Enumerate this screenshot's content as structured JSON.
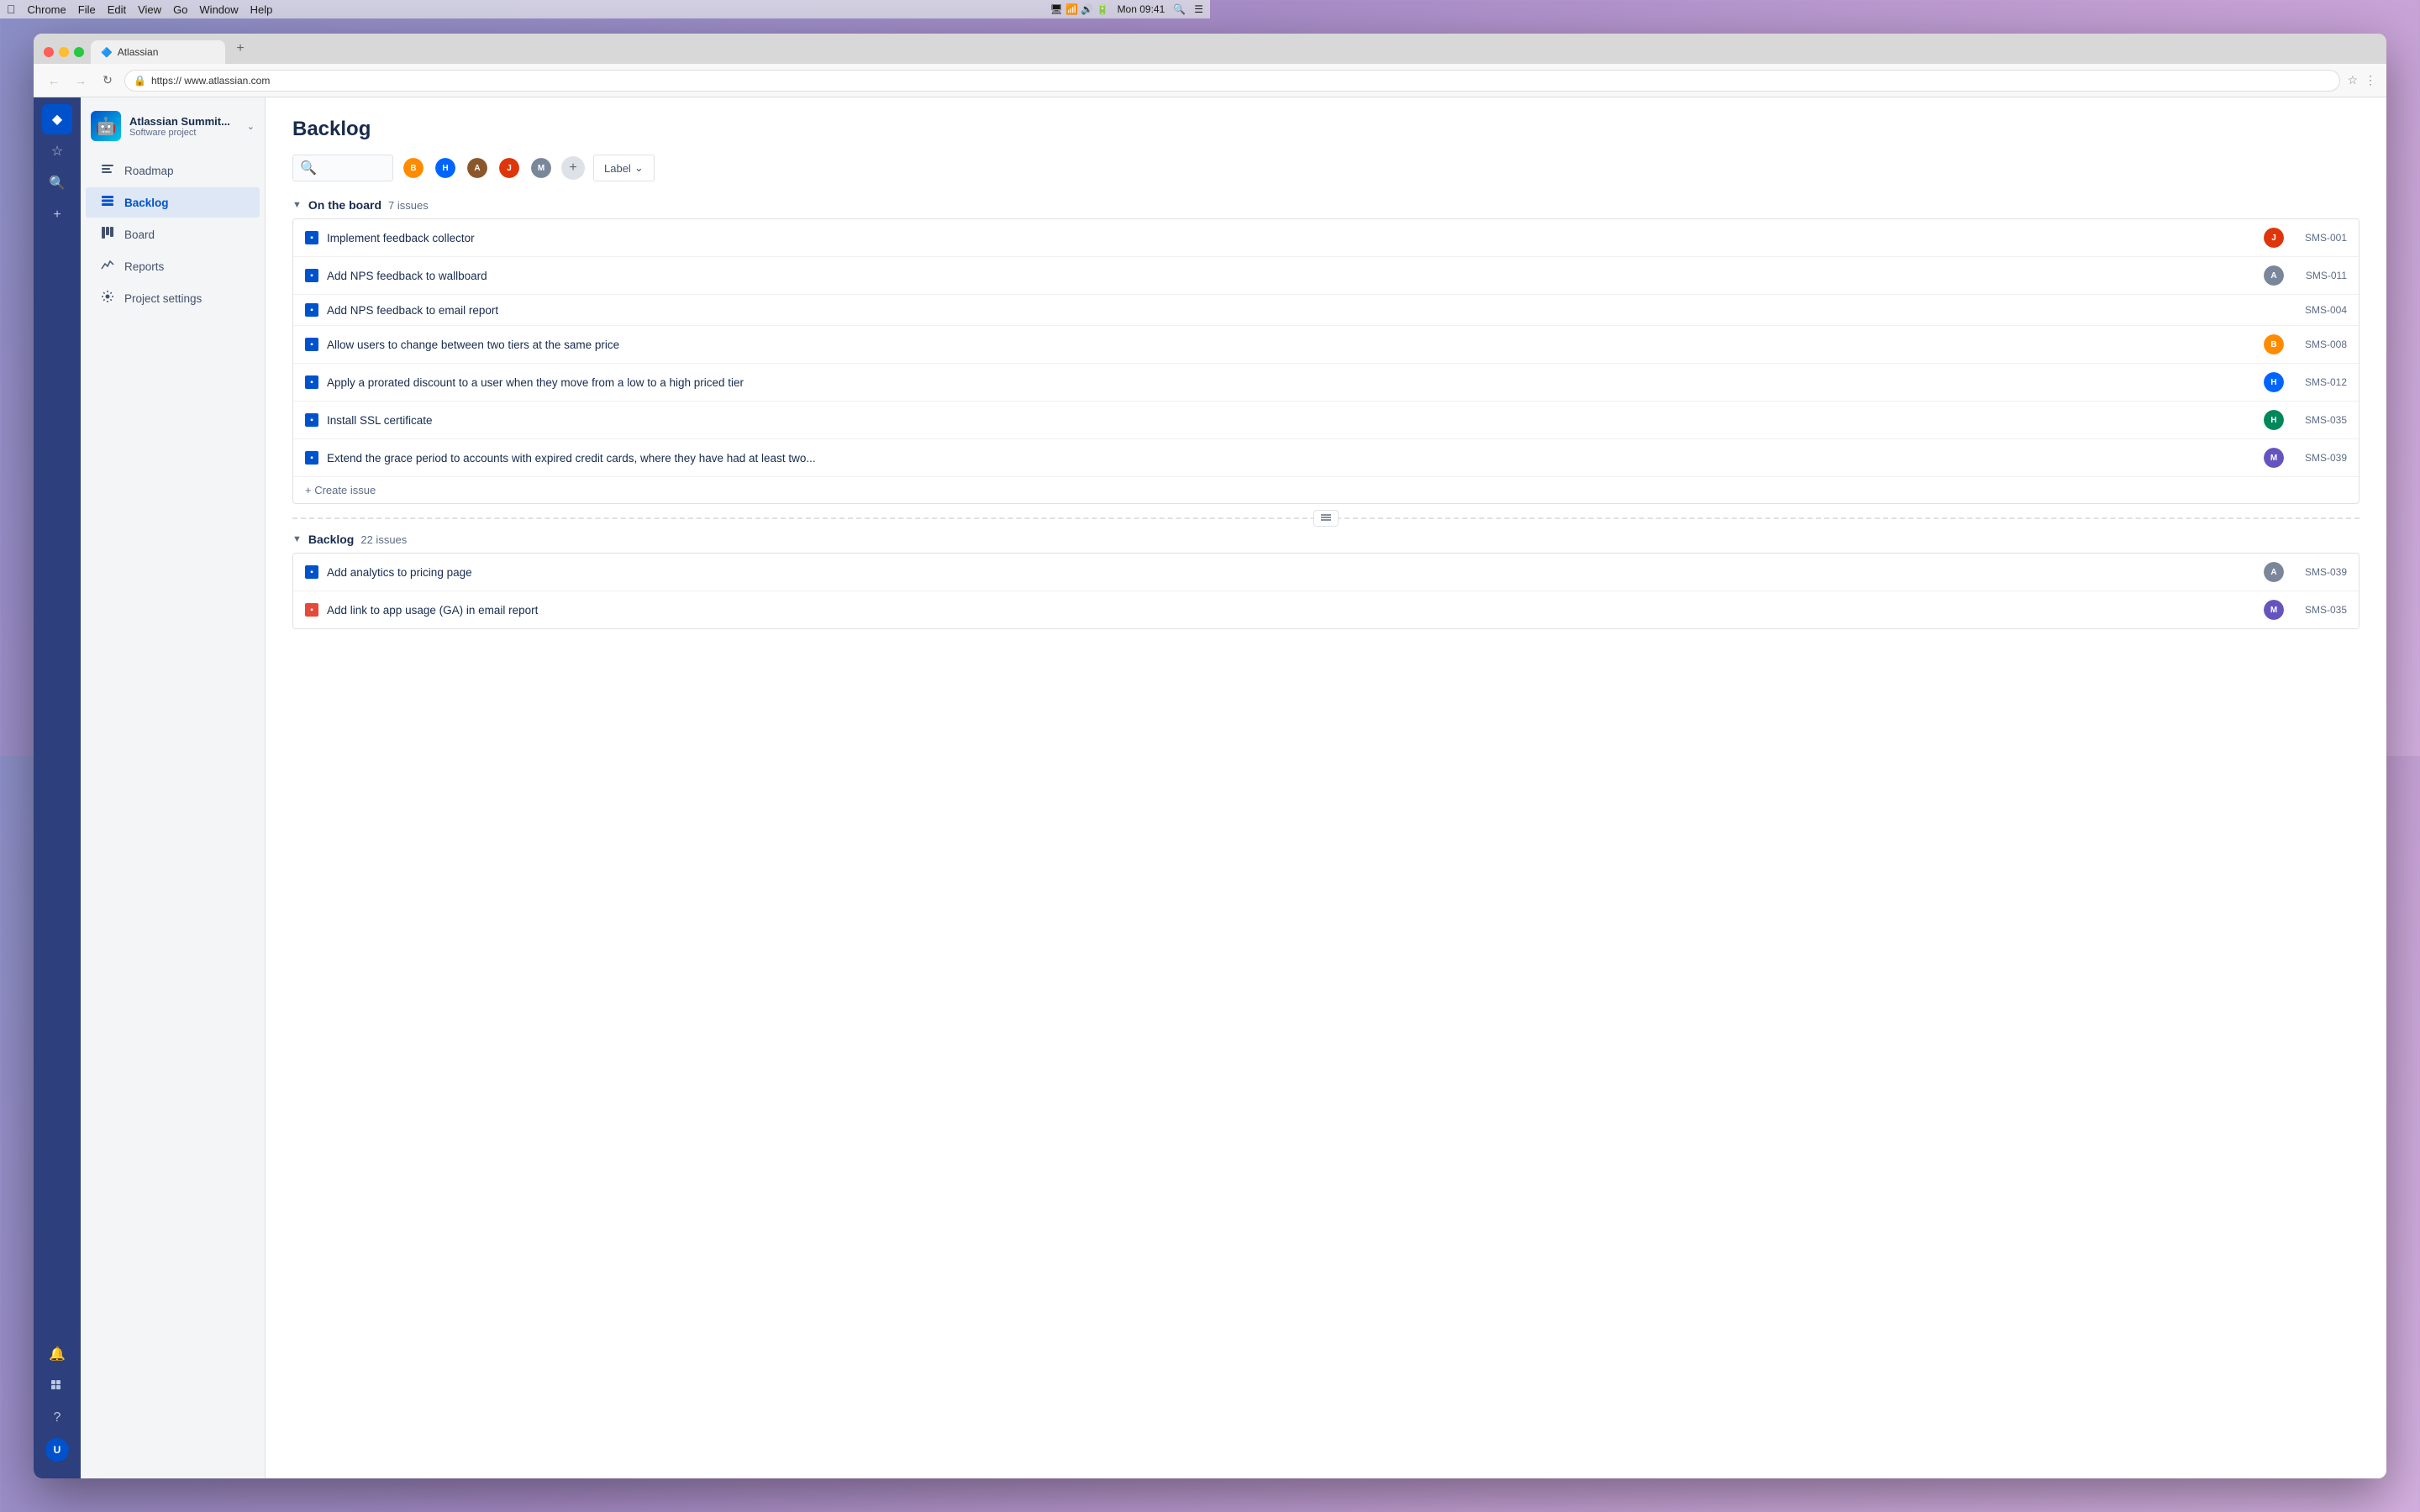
{
  "menubar": {
    "apple": "⌘",
    "menus": [
      "Chrome",
      "File",
      "Edit",
      "View",
      "Go",
      "Window",
      "Help"
    ],
    "time": "Mon 09:41"
  },
  "browser": {
    "tab": {
      "favicon": "🔷",
      "title": "Atlassian"
    },
    "url": "https://  www.atlassian.com"
  },
  "icon_sidebar": {
    "top_icons": [
      "◆",
      "☆",
      "🔍",
      "+"
    ],
    "bottom_icons": [
      "🔔",
      "⠿",
      "?"
    ]
  },
  "project": {
    "name": "Atlassian Summit...",
    "type": "Software project"
  },
  "nav": {
    "items": [
      {
        "id": "roadmap",
        "label": "Roadmap",
        "icon": "≡"
      },
      {
        "id": "backlog",
        "label": "Backlog",
        "icon": "📋",
        "active": true
      },
      {
        "id": "board",
        "label": "Board",
        "icon": "⊞"
      },
      {
        "id": "reports",
        "label": "Reports",
        "icon": "📈"
      },
      {
        "id": "project-settings",
        "label": "Project settings",
        "icon": "⚙"
      }
    ]
  },
  "main": {
    "title": "Backlog",
    "filters": {
      "search_placeholder": "Search",
      "label_btn": "Label"
    },
    "on_the_board": {
      "section_title": "On the board",
      "issue_count": "7 issues",
      "issues": [
        {
          "id": "SMS-001",
          "summary": "Implement feedback collector",
          "type": "story",
          "assignee_color": "red",
          "assignee_initials": "J"
        },
        {
          "id": "SMS-011",
          "summary": "Add NPS feedback to wallboard",
          "type": "story",
          "assignee_color": "gray",
          "assignee_initials": "A"
        },
        {
          "id": "SMS-004",
          "summary": "Add NPS feedback to email report",
          "type": "story",
          "assignee_color": null,
          "assignee_initials": ""
        },
        {
          "id": "SMS-008",
          "summary": "Allow users to change between two tiers at the same price",
          "type": "story",
          "assignee_color": "orange",
          "assignee_initials": "B"
        },
        {
          "id": "SMS-012",
          "summary": "Apply a prorated discount to a user when they move from a low to a high priced tier",
          "type": "story",
          "assignee_color": "blue",
          "assignee_initials": "H"
        },
        {
          "id": "SMS-035",
          "summary": "Install SSL certificate",
          "type": "story",
          "assignee_color": "teal",
          "assignee_initials": "H"
        },
        {
          "id": "SMS-039",
          "summary": "Extend the grace period to accounts with expired credit cards, where they have had at least two...",
          "type": "story",
          "assignee_color": "purple",
          "assignee_initials": "M"
        }
      ],
      "create_issue": "+ Create issue"
    },
    "backlog": {
      "section_title": "Backlog",
      "issue_count": "22 issues",
      "issues": [
        {
          "id": "SMS-039",
          "summary": "Add analytics to pricing page",
          "type": "story",
          "assignee_color": "gray",
          "assignee_initials": "A"
        },
        {
          "id": "SMS-035",
          "summary": "Add link to app usage (GA) in email report",
          "type": "bug",
          "assignee_color": "purple",
          "assignee_initials": "M"
        }
      ]
    }
  }
}
